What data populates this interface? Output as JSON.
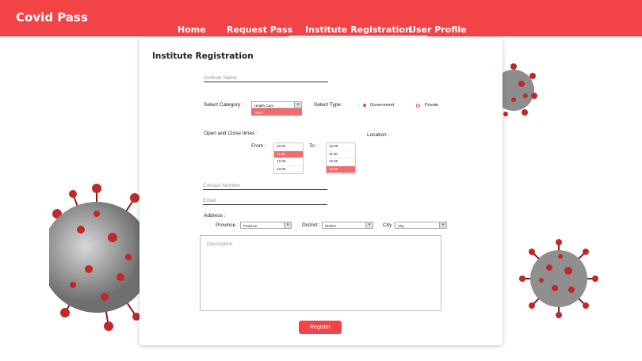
{
  "app": {
    "title": "Covid Pass"
  },
  "nav": {
    "items": [
      "Home",
      "Request Pass",
      "Institute Registration",
      "User Profile"
    ]
  },
  "form": {
    "title": "Institute Registration",
    "institute_name_placeholder": "Institute Name",
    "select_category_label": "Select Category :",
    "category_value": "Health Care",
    "category_option_highlighted": "Work",
    "select_type_label": "Select Type :",
    "type_options": [
      "Government",
      "Private"
    ],
    "open_close_label": "Open and Close times :",
    "location_label": "Location :",
    "from_label": "From :",
    "to_label": "To :",
    "from_times": [
      "10.00",
      "11.00",
      "12.00",
      "13.00"
    ],
    "to_times": [
      "10.00",
      "11.00",
      "12.00",
      "13.00"
    ],
    "contact_placeholder": "Contact Number",
    "email_placeholder": "Email",
    "address_label": "Address :",
    "province_label": "Province :",
    "province_value": "Province",
    "district_label": "District :",
    "district_value": "District",
    "city_label": "City :",
    "city_value": "City",
    "description_placeholder": "Description",
    "register_label": "Register"
  },
  "colors": {
    "accent": "#f24447",
    "highlight": "#f26b6b"
  }
}
